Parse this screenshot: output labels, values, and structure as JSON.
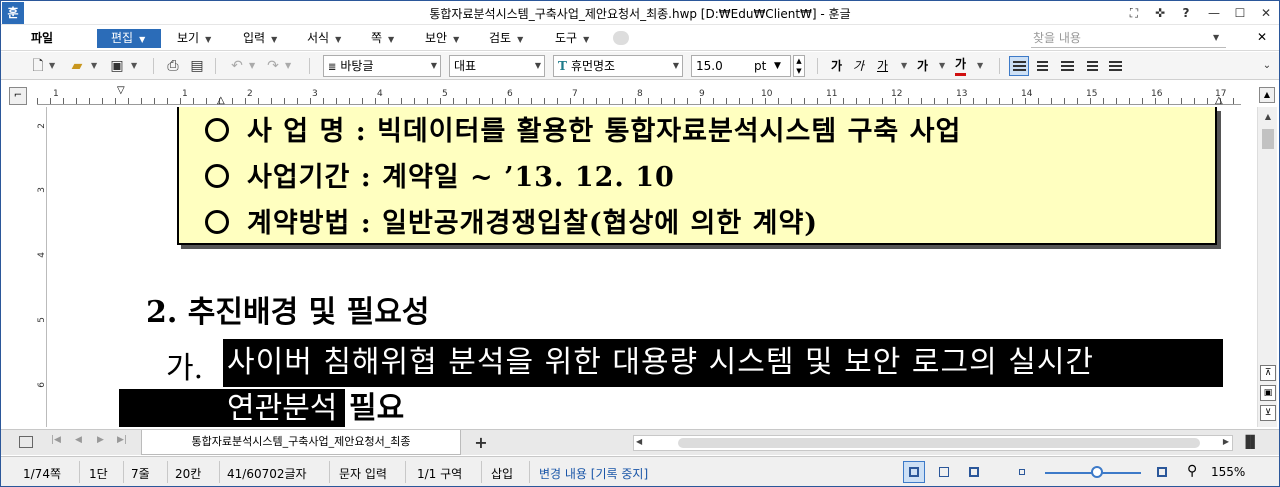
{
  "window": {
    "app_icon": "훈",
    "title": "통합자료분석시스템_구축사업_제안요청서_최종.hwp [D:₩Edu₩Client₩] - 훈글",
    "controls": [
      "⛶",
      "✜",
      "?",
      "—",
      "☐",
      "✕"
    ]
  },
  "menu": {
    "file": "파일",
    "edit": "편집",
    "view": "보기",
    "insert": "입력",
    "format": "서식",
    "page": "쪽",
    "security": "보안",
    "review": "검토",
    "tools": "도구",
    "search_placeholder": "찾을 내용",
    "close": "✕"
  },
  "toolbar": {
    "style": "바탕글",
    "outline": "대표",
    "font": "휴먼명조",
    "font_glyph": "T",
    "size": "15.0",
    "unit": "pt",
    "bold": "가",
    "italic": "가",
    "underline": "가",
    "strike": "가",
    "font_color": "가"
  },
  "ruler": {
    "marks": [
      "1",
      "1",
      "2",
      "3",
      "4",
      "5",
      "6",
      "7",
      "8",
      "9",
      "10",
      "11",
      "12",
      "13",
      "14",
      "15",
      "16",
      "17"
    ],
    "vmarks": [
      "2",
      "3",
      "4",
      "5",
      "6"
    ]
  },
  "document": {
    "info_lines": [
      "사 업 명 : 빅데이터를 활용한 통합자료분석시스템 구축 사업",
      "사업기간 : 계약일 ~ ’13. 12. 10",
      "계약방법 : 일반공개경쟁입찰(협상에 의한 계약)"
    ],
    "heading": "2. 추진배경 및 필요성",
    "sub_label": "가.",
    "selected_line1": "사이버 침해위협 분석을 위한 대용량 시스템 및 보안 로그의 실시간",
    "selected_line2": "연관분석",
    "unselected_tail": "필요"
  },
  "tabs": {
    "doc_tab": "통합자료분석시스템_구축사업_제안요청서_최종",
    "add": "+"
  },
  "status": {
    "page": "1/74쪽",
    "column": "1단",
    "line": "7줄",
    "col": "20칸",
    "chars": "41/60702글자",
    "mode": "문자 입력",
    "section": "1/1 구역",
    "insert": "삽입",
    "track": "변경 내용 [기록 중지]",
    "zoom": "155%"
  }
}
